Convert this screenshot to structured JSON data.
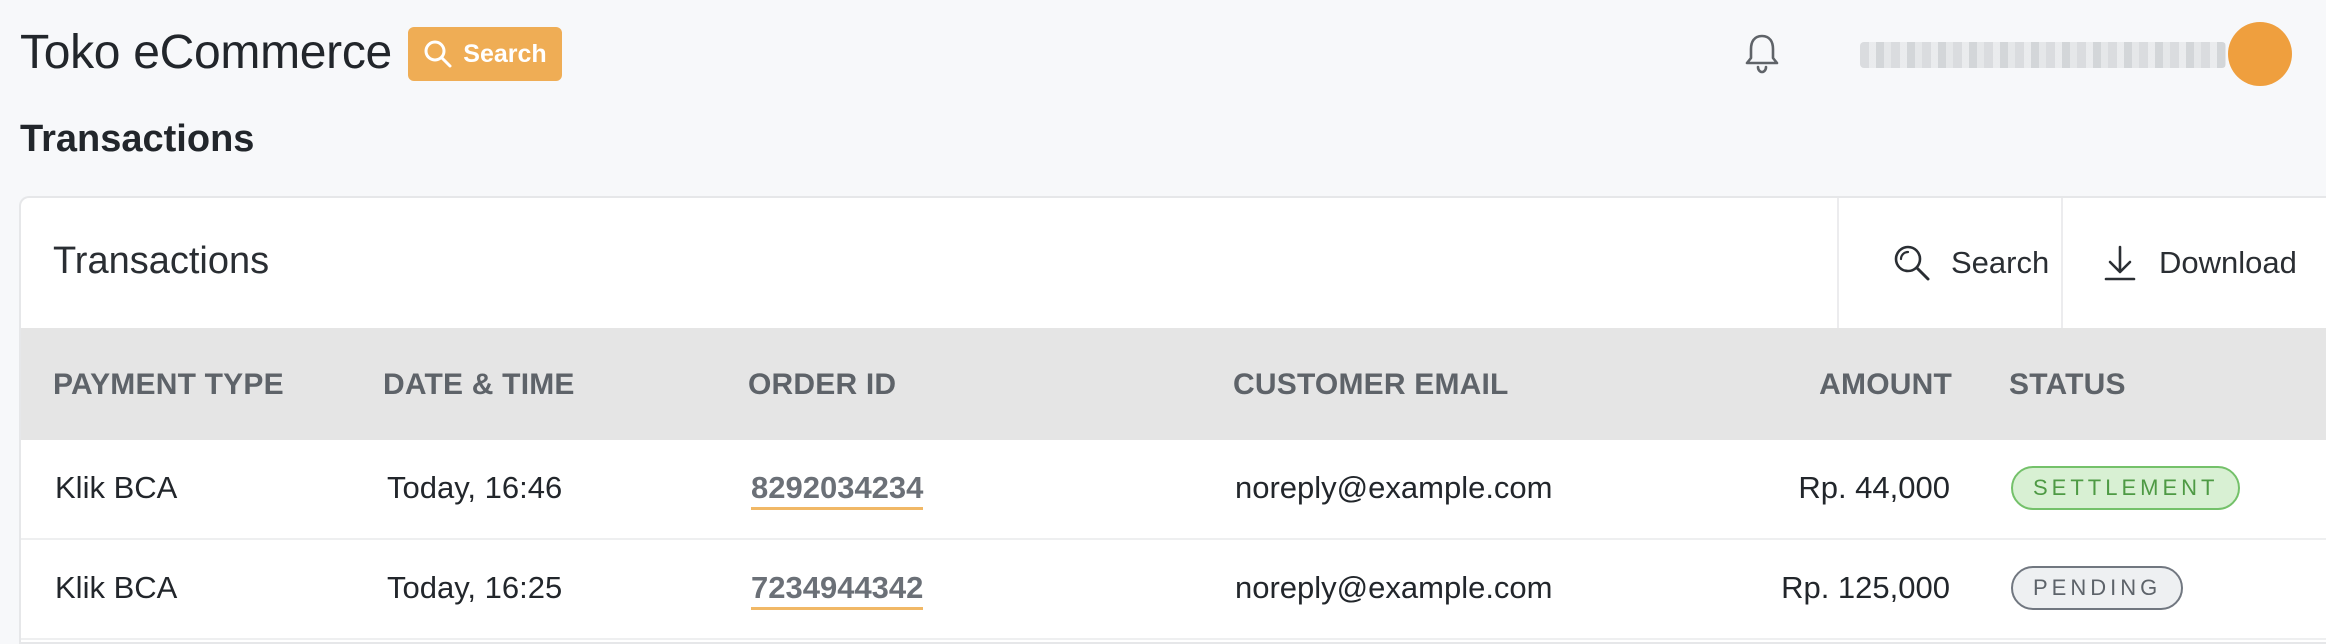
{
  "topbar": {
    "app_title": "Toko eCommerce",
    "search_button_label": "Search",
    "accent_color": "#efad55",
    "avatar_color": "#ef9f3e"
  },
  "page": {
    "title": "Transactions"
  },
  "card": {
    "title": "Transactions",
    "search_label": "Search",
    "download_label": "Download"
  },
  "table": {
    "columns": [
      "PAYMENT TYPE",
      "DATE & TIME",
      "ORDER ID",
      "CUSTOMER EMAIL",
      "AMOUNT",
      "STATUS"
    ],
    "rows": [
      {
        "payment_type": "Klik BCA",
        "date_time": "Today, 16:46",
        "order_id": "8292034234",
        "email": "noreply@example.com",
        "amount": "Rp. 44,000",
        "status": "SETTLEMENT",
        "status_color": "#74c16a"
      },
      {
        "payment_type": "Klik BCA",
        "date_time": "Today, 16:25",
        "order_id": "7234944342",
        "email": "noreply@example.com",
        "amount": "Rp. 125,000",
        "status": "PENDING",
        "status_color": "#717780"
      }
    ]
  }
}
